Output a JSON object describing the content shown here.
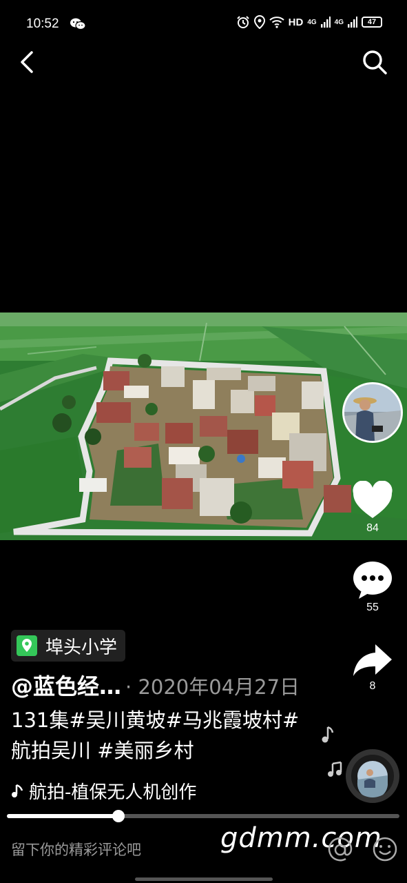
{
  "status_bar": {
    "time": "10:52",
    "network_hd": "HD",
    "net_1": "4G",
    "net_2": "4G",
    "battery": "47",
    "icons": [
      "wechat-icon",
      "alarm-icon",
      "location-icon",
      "wifi-icon",
      "signal-icon",
      "battery-icon"
    ]
  },
  "top_bar": {
    "back_icon": "chevron-left-icon",
    "search_icon": "search-icon"
  },
  "video": {
    "description_icon": "aerial-village-video"
  },
  "actions": {
    "like_count": "84",
    "comment_count": "55",
    "share_count": "8"
  },
  "location": {
    "name": "埠头小学",
    "color": "#34c759"
  },
  "post": {
    "author": "@蓝色经…",
    "date": "· 2020年04月27日",
    "caption": "131集#吴川黄坡#马兆霞坡村#航拍吴川 #美丽乡村"
  },
  "music": {
    "title": "航拍-植保无人机创作"
  },
  "progress": {
    "fraction": 0.285
  },
  "comment_bar": {
    "placeholder": "留下你的精彩评论吧"
  },
  "watermark": "gdmm.com"
}
